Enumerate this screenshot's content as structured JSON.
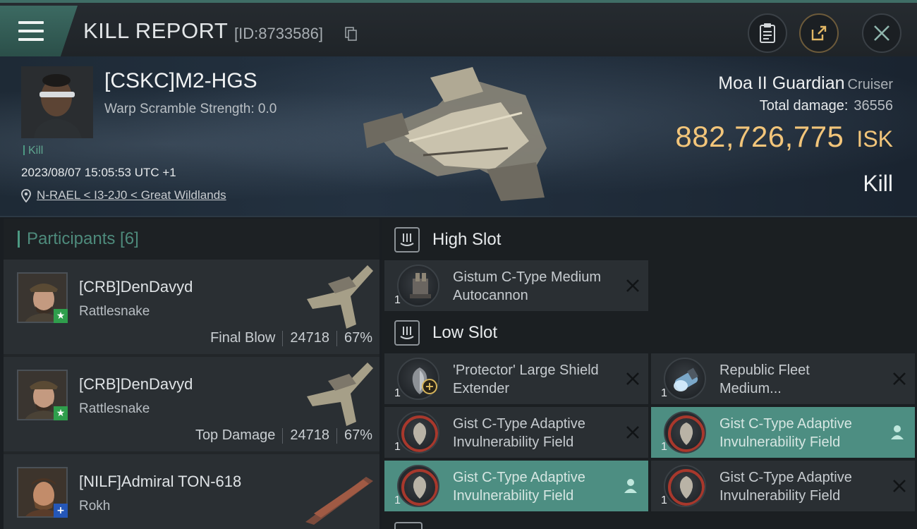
{
  "header_bar": {
    "title": "KILL REPORT",
    "report_id": "[ID:8733586]"
  },
  "victim": {
    "name": "[CSKC]M2-HGS",
    "warp_scramble": "Warp Scramble Strength: 0.0",
    "tag": "Kill",
    "datetime": "2023/08/07 15:05:53 UTC +1",
    "location": "N-RAEL < I3-2J0 < Great Wildlands",
    "ship_name": "Moa II Guardian",
    "ship_class": "Cruiser",
    "total_damage_label": "Total damage:",
    "total_damage_value": "36556",
    "isk_value": "882,726,775",
    "isk_unit": "ISK",
    "result": "Kill"
  },
  "participants": {
    "title": "Participants [6]",
    "items": [
      {
        "name": "[CRB]DenDavyd",
        "ship": "Rattlesnake",
        "role": "Final Blow",
        "damage": "24718",
        "percent": "67%",
        "badge": "★",
        "badge_color": "#2f9e4c"
      },
      {
        "name": "[CRB]DenDavyd",
        "ship": "Rattlesnake",
        "role": "Top Damage",
        "damage": "24718",
        "percent": "67%",
        "badge": "★",
        "badge_color": "#2f9e4c"
      },
      {
        "name": "[NILF]Admiral TON-618",
        "ship": "Rokh",
        "role": "",
        "damage": "",
        "percent": "",
        "badge": "+",
        "badge_color": "#2557b8"
      }
    ]
  },
  "fitting": {
    "high_slot_label": "High Slot",
    "low_slot_label": "Low Slot",
    "high": [
      {
        "name": "Gistum C-Type Medium Autocannon",
        "qty": "1",
        "state": "destroyed"
      }
    ],
    "low": [
      {
        "name": "'Protector' Large Shield Extender",
        "qty": "1",
        "state": "destroyed"
      },
      {
        "name": "Republic Fleet Medium...",
        "qty": "1",
        "state": "destroyed"
      },
      {
        "name": "Gist C-Type Adaptive Invulnerability Field",
        "qty": "1",
        "state": "destroyed"
      },
      {
        "name": "Gist C-Type Adaptive Invulnerability Field",
        "qty": "1",
        "state": "dropped"
      },
      {
        "name": "Gist C-Type Adaptive Invulnerability Field",
        "qty": "1",
        "state": "dropped"
      },
      {
        "name": "Gist C-Type Adaptive Invulnerability Field",
        "qty": "1",
        "state": "destroyed"
      }
    ]
  },
  "colors": {
    "accent": "#4d9a83",
    "isk": "#f2c57a",
    "active_row": "#4d8e82"
  }
}
